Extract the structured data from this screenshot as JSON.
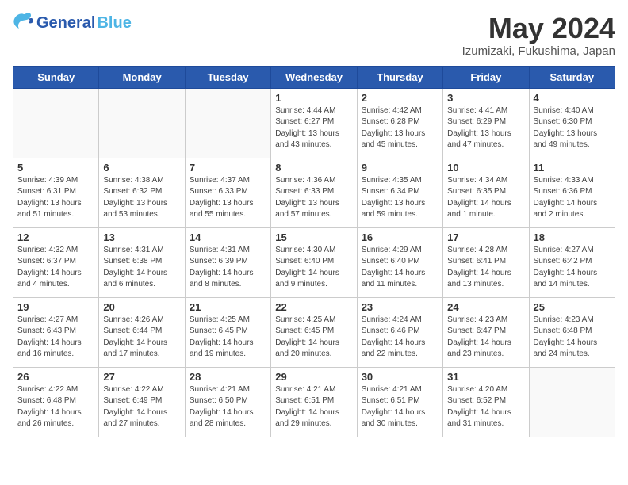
{
  "logo": {
    "general": "General",
    "blue": "Blue"
  },
  "header": {
    "month": "May 2024",
    "location": "Izumizaki, Fukushima, Japan"
  },
  "weekdays": [
    "Sunday",
    "Monday",
    "Tuesday",
    "Wednesday",
    "Thursday",
    "Friday",
    "Saturday"
  ],
  "weeks": [
    [
      {
        "day": "",
        "info": ""
      },
      {
        "day": "",
        "info": ""
      },
      {
        "day": "",
        "info": ""
      },
      {
        "day": "1",
        "info": "Sunrise: 4:44 AM\nSunset: 6:27 PM\nDaylight: 13 hours\nand 43 minutes."
      },
      {
        "day": "2",
        "info": "Sunrise: 4:42 AM\nSunset: 6:28 PM\nDaylight: 13 hours\nand 45 minutes."
      },
      {
        "day": "3",
        "info": "Sunrise: 4:41 AM\nSunset: 6:29 PM\nDaylight: 13 hours\nand 47 minutes."
      },
      {
        "day": "4",
        "info": "Sunrise: 4:40 AM\nSunset: 6:30 PM\nDaylight: 13 hours\nand 49 minutes."
      }
    ],
    [
      {
        "day": "5",
        "info": "Sunrise: 4:39 AM\nSunset: 6:31 PM\nDaylight: 13 hours\nand 51 minutes."
      },
      {
        "day": "6",
        "info": "Sunrise: 4:38 AM\nSunset: 6:32 PM\nDaylight: 13 hours\nand 53 minutes."
      },
      {
        "day": "7",
        "info": "Sunrise: 4:37 AM\nSunset: 6:33 PM\nDaylight: 13 hours\nand 55 minutes."
      },
      {
        "day": "8",
        "info": "Sunrise: 4:36 AM\nSunset: 6:33 PM\nDaylight: 13 hours\nand 57 minutes."
      },
      {
        "day": "9",
        "info": "Sunrise: 4:35 AM\nSunset: 6:34 PM\nDaylight: 13 hours\nand 59 minutes."
      },
      {
        "day": "10",
        "info": "Sunrise: 4:34 AM\nSunset: 6:35 PM\nDaylight: 14 hours\nand 1 minute."
      },
      {
        "day": "11",
        "info": "Sunrise: 4:33 AM\nSunset: 6:36 PM\nDaylight: 14 hours\nand 2 minutes."
      }
    ],
    [
      {
        "day": "12",
        "info": "Sunrise: 4:32 AM\nSunset: 6:37 PM\nDaylight: 14 hours\nand 4 minutes."
      },
      {
        "day": "13",
        "info": "Sunrise: 4:31 AM\nSunset: 6:38 PM\nDaylight: 14 hours\nand 6 minutes."
      },
      {
        "day": "14",
        "info": "Sunrise: 4:31 AM\nSunset: 6:39 PM\nDaylight: 14 hours\nand 8 minutes."
      },
      {
        "day": "15",
        "info": "Sunrise: 4:30 AM\nSunset: 6:40 PM\nDaylight: 14 hours\nand 9 minutes."
      },
      {
        "day": "16",
        "info": "Sunrise: 4:29 AM\nSunset: 6:40 PM\nDaylight: 14 hours\nand 11 minutes."
      },
      {
        "day": "17",
        "info": "Sunrise: 4:28 AM\nSunset: 6:41 PM\nDaylight: 14 hours\nand 13 minutes."
      },
      {
        "day": "18",
        "info": "Sunrise: 4:27 AM\nSunset: 6:42 PM\nDaylight: 14 hours\nand 14 minutes."
      }
    ],
    [
      {
        "day": "19",
        "info": "Sunrise: 4:27 AM\nSunset: 6:43 PM\nDaylight: 14 hours\nand 16 minutes."
      },
      {
        "day": "20",
        "info": "Sunrise: 4:26 AM\nSunset: 6:44 PM\nDaylight: 14 hours\nand 17 minutes."
      },
      {
        "day": "21",
        "info": "Sunrise: 4:25 AM\nSunset: 6:45 PM\nDaylight: 14 hours\nand 19 minutes."
      },
      {
        "day": "22",
        "info": "Sunrise: 4:25 AM\nSunset: 6:45 PM\nDaylight: 14 hours\nand 20 minutes."
      },
      {
        "day": "23",
        "info": "Sunrise: 4:24 AM\nSunset: 6:46 PM\nDaylight: 14 hours\nand 22 minutes."
      },
      {
        "day": "24",
        "info": "Sunrise: 4:23 AM\nSunset: 6:47 PM\nDaylight: 14 hours\nand 23 minutes."
      },
      {
        "day": "25",
        "info": "Sunrise: 4:23 AM\nSunset: 6:48 PM\nDaylight: 14 hours\nand 24 minutes."
      }
    ],
    [
      {
        "day": "26",
        "info": "Sunrise: 4:22 AM\nSunset: 6:48 PM\nDaylight: 14 hours\nand 26 minutes."
      },
      {
        "day": "27",
        "info": "Sunrise: 4:22 AM\nSunset: 6:49 PM\nDaylight: 14 hours\nand 27 minutes."
      },
      {
        "day": "28",
        "info": "Sunrise: 4:21 AM\nSunset: 6:50 PM\nDaylight: 14 hours\nand 28 minutes."
      },
      {
        "day": "29",
        "info": "Sunrise: 4:21 AM\nSunset: 6:51 PM\nDaylight: 14 hours\nand 29 minutes."
      },
      {
        "day": "30",
        "info": "Sunrise: 4:21 AM\nSunset: 6:51 PM\nDaylight: 14 hours\nand 30 minutes."
      },
      {
        "day": "31",
        "info": "Sunrise: 4:20 AM\nSunset: 6:52 PM\nDaylight: 14 hours\nand 31 minutes."
      },
      {
        "day": "",
        "info": ""
      }
    ]
  ],
  "colors": {
    "header_bg": "#2a5aad",
    "header_text": "#ffffff"
  }
}
